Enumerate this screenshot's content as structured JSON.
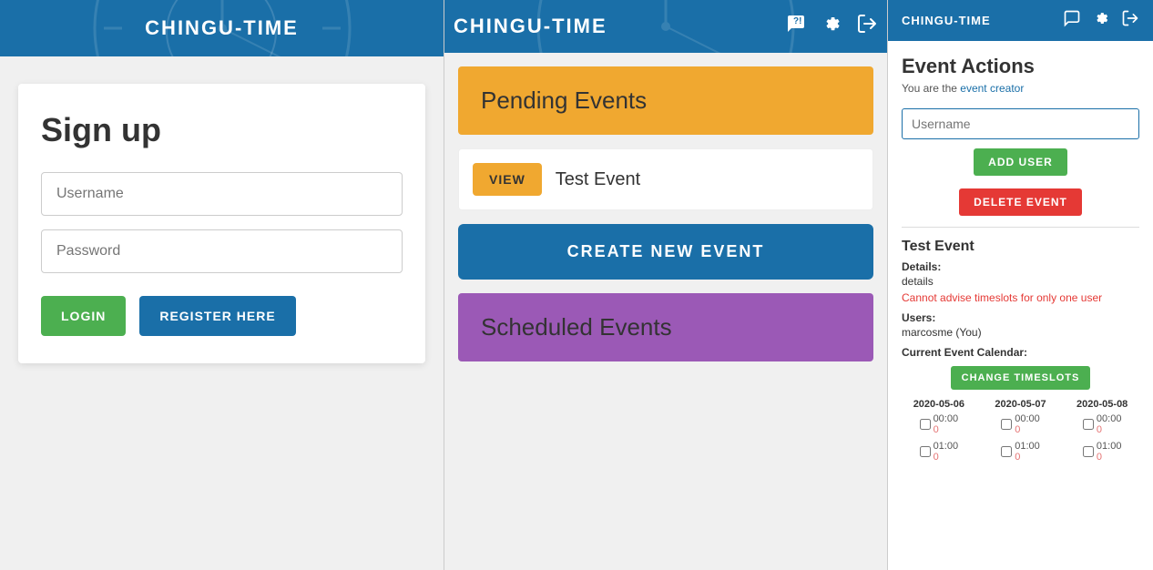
{
  "panel1": {
    "header": {
      "title": "CHINGU-TIME"
    },
    "signup": {
      "title": "Sign up",
      "username_placeholder": "Username",
      "password_placeholder": "Password",
      "login_button": "LOGIN",
      "register_button": "REGISTER HERE"
    }
  },
  "panel2": {
    "header": {
      "title": "CHINGU-TIME",
      "icon_chat": "💬",
      "icon_settings": "⚙",
      "icon_logout": "🚪"
    },
    "pending_events": {
      "title": "Pending Events",
      "view_button": "VIEW",
      "event_name": "Test Event"
    },
    "create_button": "CREATE NEW EVENT",
    "scheduled_events": {
      "title": "Scheduled Events"
    }
  },
  "panel3": {
    "header": {
      "title": "CHINGU-TIME",
      "icon_chat": "💬",
      "icon_settings": "⚙",
      "icon_logout": "🚪"
    },
    "event_actions": {
      "title": "Event Actions",
      "subtitle": "You are the event creator",
      "username_placeholder": "Username",
      "add_user_button": "ADD USER",
      "delete_event_button": "DELETE EVENT"
    },
    "test_event": {
      "title": "Test Event",
      "details_label": "Details:",
      "details_value": "details",
      "warning": "Cannot advise timeslots for only one user",
      "users_label": "Users:",
      "users_value": "marcosme (You)",
      "calendar_label": "Current Event Calendar:",
      "change_timeslots_button": "CHANGE TIMESLOTS",
      "calendar": {
        "columns": [
          {
            "date": "2020-05-06",
            "slots": [
              {
                "time": "00:00",
                "count": "0"
              },
              {
                "time": "01:00",
                "count": "0"
              }
            ]
          },
          {
            "date": "2020-05-07",
            "slots": [
              {
                "time": "00:00",
                "count": "0"
              },
              {
                "time": "01:00",
                "count": "0"
              }
            ]
          },
          {
            "date": "2020-05-08",
            "slots": [
              {
                "time": "00:00",
                "count": "0"
              },
              {
                "time": "01:00",
                "count": "0"
              }
            ]
          }
        ]
      }
    }
  }
}
